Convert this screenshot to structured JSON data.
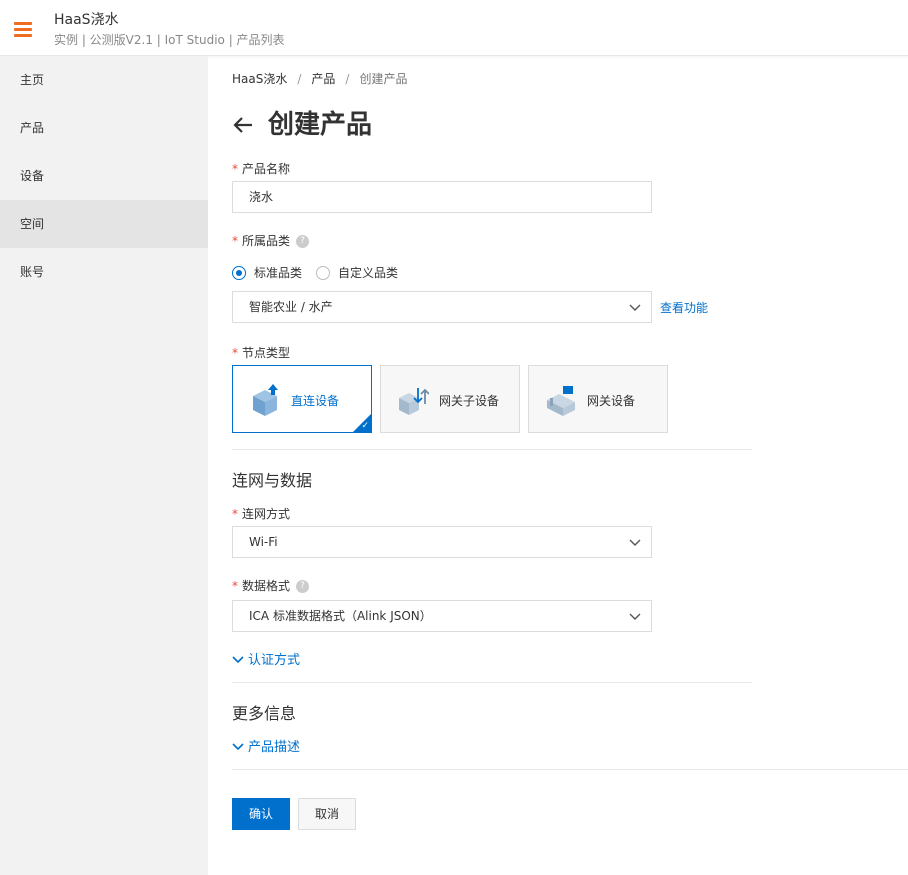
{
  "header": {
    "title": "HaaS浇水",
    "subtitle": "实例 | 公测版V2.1 | IoT Studio | 产品列表"
  },
  "sidebar": {
    "items": [
      {
        "label": "主页"
      },
      {
        "label": "产品"
      },
      {
        "label": "设备"
      },
      {
        "label": "空间",
        "active": true
      },
      {
        "label": "账号"
      }
    ]
  },
  "breadcrumb": [
    "HaaS浇水",
    "产品",
    "创建产品"
  ],
  "page": {
    "title": "创建产品"
  },
  "form": {
    "product_name_label": "产品名称",
    "product_name_value": "浇水",
    "category_label": "所属品类",
    "category_options": [
      "标准品类",
      "自定义品类"
    ],
    "category_selected": "标准品类",
    "category_value": "智能农业 / 水产",
    "view_features_link": "查看功能",
    "node_type_label": "节点类型",
    "node_types": [
      "直连设备",
      "网关子设备",
      "网关设备"
    ],
    "node_type_selected": "直连设备",
    "network_section_title": "连网与数据",
    "network_method_label": "连网方式",
    "network_method_value": "Wi-Fi",
    "data_format_label": "数据格式",
    "data_format_value": "ICA 标准数据格式（Alink JSON）",
    "auth_expander": "认证方式",
    "more_info_title": "更多信息",
    "description_expander": "产品描述",
    "confirm_button": "确认",
    "cancel_button": "取消",
    "required_mark": "*",
    "help_mark": "?"
  },
  "colors": {
    "accent": "#0070cc",
    "menu_icon": "#ef6d21",
    "required": "#e84b3c"
  }
}
